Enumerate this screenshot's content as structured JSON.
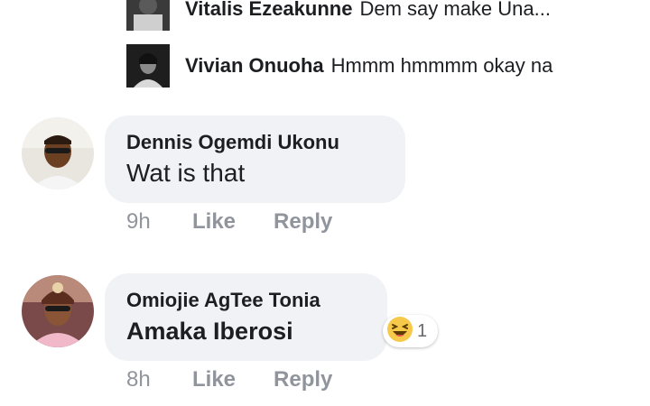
{
  "replies": [
    {
      "name": "Vitalis Ezeakunne",
      "text": "Dem say make Una..."
    },
    {
      "name": "Vivian Onuoha",
      "text": "Hmmm hmmmm okay na"
    }
  ],
  "comments": [
    {
      "author": "Dennis Ogemdi Ukonu",
      "text": "Wat is that",
      "time": "9h",
      "like_label": "Like",
      "reply_label": "Reply"
    },
    {
      "author": "Omiojie AgTee Tonia",
      "text": "Amaka Iberosi",
      "time": "8h",
      "like_label": "Like",
      "reply_label": "Reply",
      "reaction": {
        "icon": "laughing-face-icon",
        "count": "1"
      }
    }
  ],
  "colors": {
    "bubble": "#f0f2f5",
    "meta_text": "#90949c",
    "name_text": "#1c1e21",
    "reaction_yellow": "#f7c94b"
  }
}
